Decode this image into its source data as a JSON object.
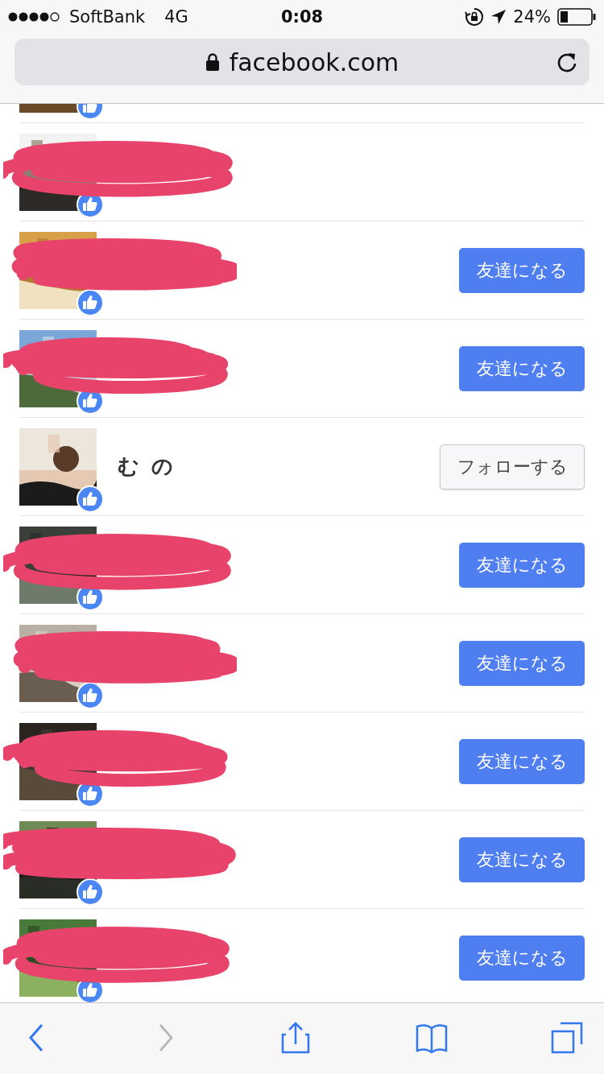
{
  "status_bar": {
    "carrier": "SoftBank",
    "network": "4G",
    "time": "0:08",
    "battery": "24%"
  },
  "address_bar": {
    "url": "facebook.com"
  },
  "rows": [
    {
      "kind": "partial",
      "redacted": false
    },
    {
      "kind": "full",
      "redacted": true
    },
    {
      "kind": "full",
      "redacted": true,
      "action": {
        "kind": "add_friend",
        "label": "友達になる"
      }
    },
    {
      "kind": "full",
      "redacted": true,
      "action": {
        "kind": "add_friend",
        "label": "友達になる"
      }
    },
    {
      "kind": "full",
      "redacted": false,
      "name": "む の",
      "action": {
        "kind": "follow",
        "label": "フォローする"
      }
    },
    {
      "kind": "full",
      "redacted": true,
      "action": {
        "kind": "add_friend",
        "label": "友達になる"
      }
    },
    {
      "kind": "full",
      "redacted": true,
      "action": {
        "kind": "add_friend",
        "label": "友達になる"
      }
    },
    {
      "kind": "full",
      "redacted": true,
      "action": {
        "kind": "add_friend",
        "label": "友達になる"
      }
    },
    {
      "kind": "full",
      "redacted": true,
      "action": {
        "kind": "add_friend",
        "label": "友達になる"
      }
    },
    {
      "kind": "full",
      "redacted": true,
      "action": {
        "kind": "add_friend",
        "label": "友達になる"
      }
    }
  ],
  "toolbar": [
    {
      "kind": "back",
      "disabled": false
    },
    {
      "kind": "forward",
      "disabled": true
    },
    {
      "kind": "share",
      "disabled": false
    },
    {
      "kind": "bookmarks",
      "disabled": false
    },
    {
      "kind": "tabs",
      "disabled": false
    }
  ]
}
